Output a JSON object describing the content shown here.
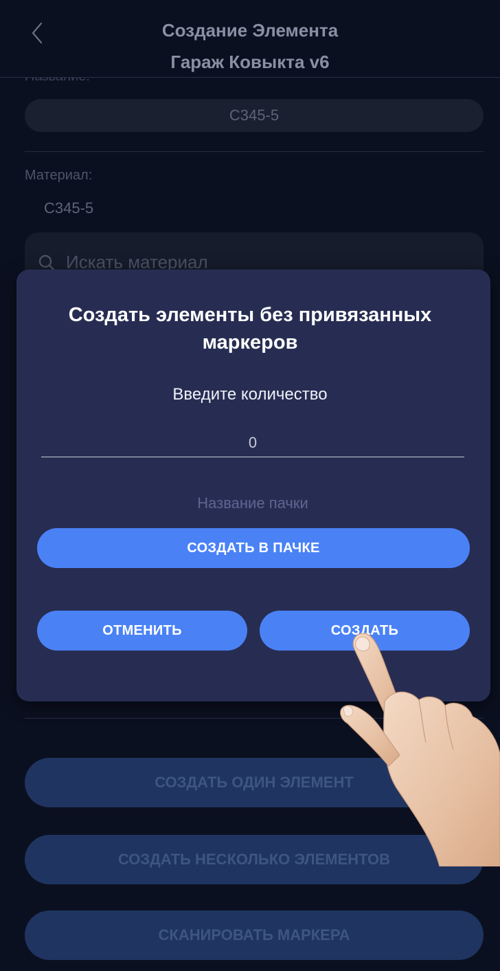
{
  "header": {
    "title": "Создание Элемента",
    "subtitle": "Гараж Ковыкта v6"
  },
  "form": {
    "name_label": "Название:",
    "name_value": "C345-5",
    "material_label": "Материал:",
    "material_value": "C345-5",
    "search_placeholder": "Искать материал"
  },
  "modal": {
    "title": "Создать элементы без привязанных маркеров",
    "quantity_label": "Введите количество",
    "quantity_value": "0",
    "pack_name_placeholder": "Название пачки",
    "create_in_pack_label": "СОЗДАТЬ В ПАЧКЕ",
    "cancel_label": "ОТМЕНИТЬ",
    "create_label": "СОЗДАТЬ"
  },
  "actions": {
    "create_one": "СОЗДАТЬ ОДИН ЭЛЕМЕНТ",
    "create_several": "СОЗДАТЬ НЕСКОЛЬКО ЭЛЕМЕНТОВ",
    "scan_markers": "СКАНИРОВАТЬ МАРКЕРА"
  },
  "colors": {
    "accent": "#4a82f6",
    "modal_bg": "#272d52",
    "app_bg": "#0b1020"
  },
  "icons": [
    "back-chevron-icon",
    "search-icon",
    "pointing-hand"
  ]
}
